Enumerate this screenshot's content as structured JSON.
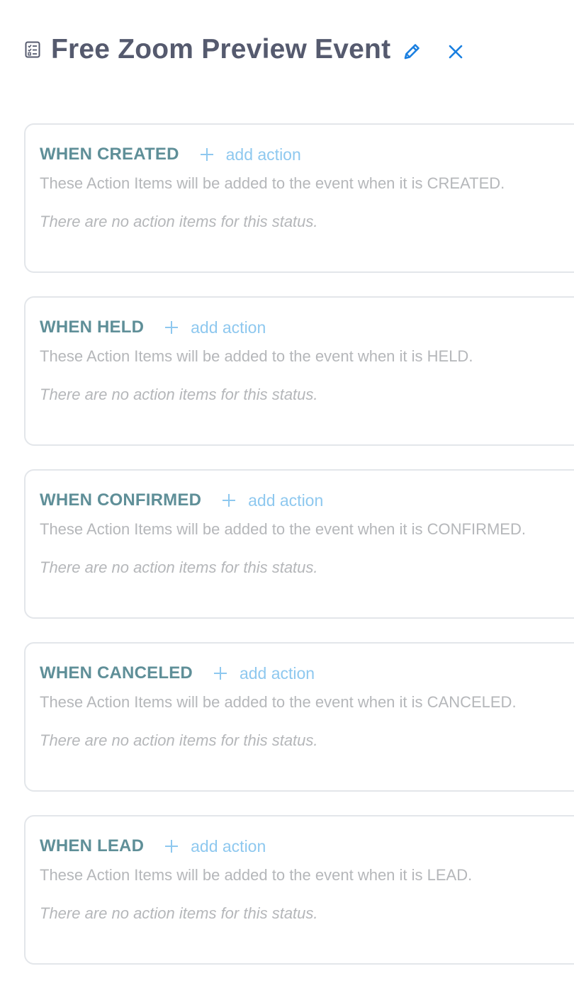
{
  "header": {
    "title": "Free Zoom Preview Event",
    "icons": {
      "doc": "checklist-icon",
      "edit": "pencil-icon",
      "close": "close-icon"
    }
  },
  "colors": {
    "title": "#555a6e",
    "status_label": "#5f8f98",
    "accent": "#1a7fe0",
    "add_action": "#8ec8ef",
    "muted_text": "#b5b7ba",
    "card_border": "#e3e6ea"
  },
  "statuses": [
    {
      "label": "WHEN CREATED",
      "add_label": "add action",
      "description": "These Action Items will be added to the event when it is CREATED.",
      "empty_text": "There are no action items for this status."
    },
    {
      "label": "WHEN HELD",
      "add_label": "add action",
      "description": "These Action Items will be added to the event when it is HELD.",
      "empty_text": "There are no action items for this status."
    },
    {
      "label": "WHEN CONFIRMED",
      "add_label": "add action",
      "description": "These Action Items will be added to the event when it is CONFIRMED.",
      "empty_text": "There are no action items for this status."
    },
    {
      "label": "WHEN CANCELED",
      "add_label": "add action",
      "description": "These Action Items will be added to the event when it is CANCELED.",
      "empty_text": "There are no action items for this status."
    },
    {
      "label": "WHEN LEAD",
      "add_label": "add action",
      "description": "These Action Items will be added to the event when it is LEAD.",
      "empty_text": "There are no action items for this status."
    }
  ]
}
